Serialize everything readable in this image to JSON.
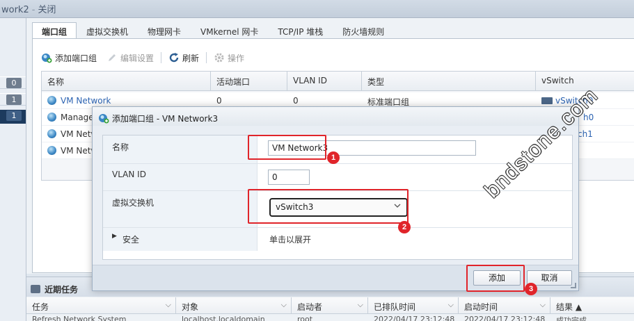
{
  "title_bar": {
    "host": "work2",
    "separator": "-",
    "state": "关闭"
  },
  "left_panel": {
    "badges": [
      "0",
      "1",
      "1"
    ]
  },
  "tabs": [
    "端口组",
    "虚拟交换机",
    "物理网卡",
    "VMkernel 网卡",
    "TCP/IP 堆栈",
    "防火墙规则"
  ],
  "toolbar": {
    "add": "添加端口组",
    "edit": "编辑设置",
    "refresh": "刷新",
    "actions": "操作"
  },
  "grid": {
    "columns": [
      "名称",
      "活动端口",
      "VLAN ID",
      "类型",
      "vSwitch"
    ],
    "rows": [
      {
        "name": "VM Network",
        "active": "0",
        "vlan": "0",
        "type": "标准端口组",
        "vswitch": "vSwitch0"
      },
      {
        "name": "Manager",
        "active": "",
        "vlan": "",
        "type": "",
        "vswitch": "h0"
      },
      {
        "name": "VM Netw",
        "active": "",
        "vlan": "",
        "type": "",
        "vswitch": "ch1"
      },
      {
        "name": "VM Netw",
        "active": "",
        "vlan": "",
        "type": "",
        "vswitch": ""
      }
    ]
  },
  "tasks": {
    "title": "近期任务",
    "columns": [
      "任务",
      "对象",
      "启动者",
      "已排队时间",
      "启动时间",
      "结果 ▲"
    ],
    "row": [
      "Refresh Network System",
      "localhost.localdomain",
      "root",
      "2022/04/17 23:12:48",
      "2022/04/17 23:12:48",
      "成功完成"
    ]
  },
  "dialog": {
    "title": "添加端口组 - VM Network3",
    "fields": {
      "name_label": "名称",
      "name_value": "VM Network3",
      "vlan_label": "VLAN ID",
      "vlan_value": "0",
      "vswitch_label": "虚拟交换机",
      "vswitch_value": "vSwitch3",
      "security_label": "安全",
      "security_hint": "单击以展开"
    },
    "buttons": {
      "add": "添加",
      "cancel": "取消"
    }
  },
  "annotations": [
    "1",
    "2",
    "3"
  ],
  "watermark": "bndstone.com",
  "colors": {
    "annotation": "#e0242a",
    "link": "#2c63b2",
    "nav_dark": "#1c3a5e"
  }
}
